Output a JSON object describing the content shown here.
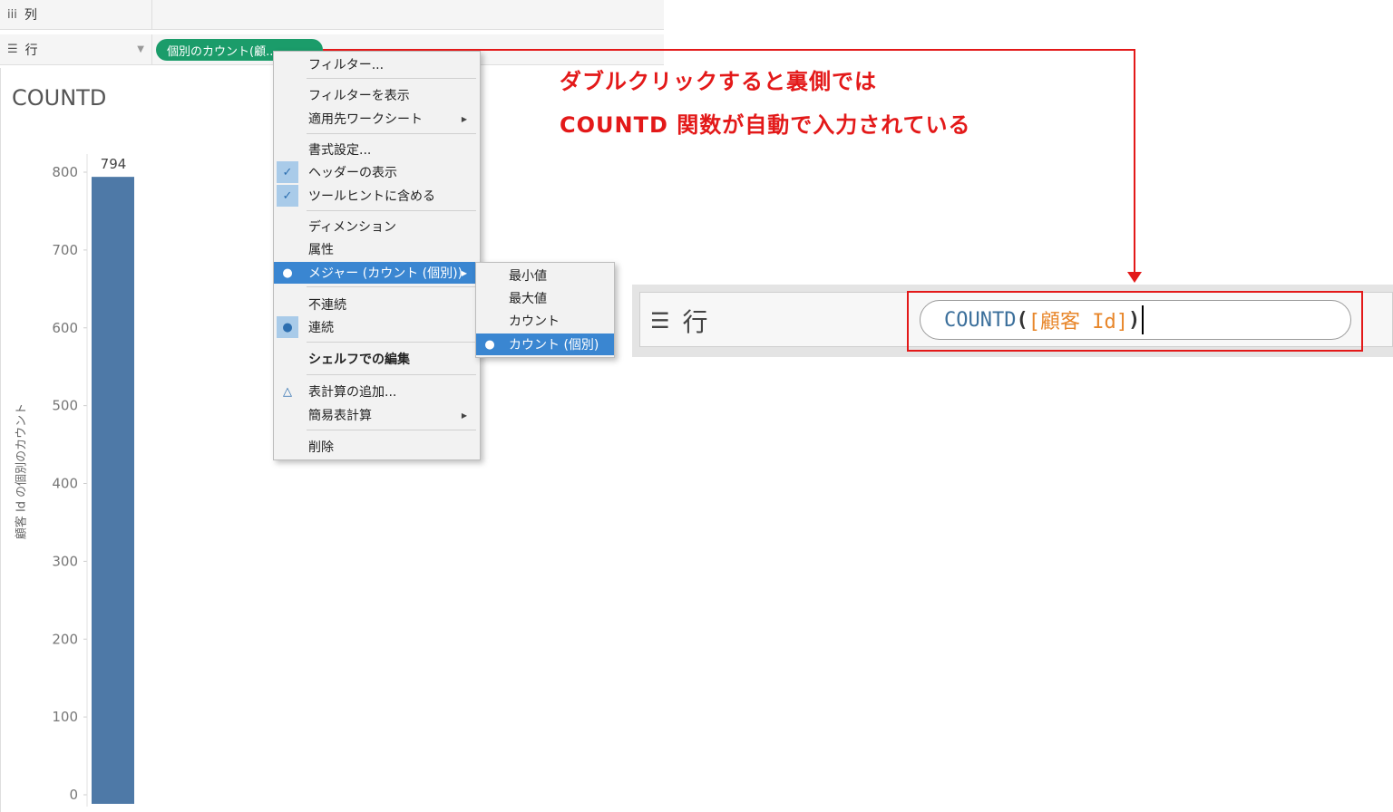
{
  "shelves": {
    "columns_icon": "iii",
    "columns_label": "列",
    "rows_icon": "☰",
    "rows_label": "行",
    "rows_pill": "個別のカウント(顧..."
  },
  "chart": {
    "title": "COUNTD"
  },
  "chart_data": {
    "type": "bar",
    "categories": [
      ""
    ],
    "values": [
      794
    ],
    "data_labels": [
      "794"
    ],
    "title": "COUNTD",
    "xlabel": "",
    "ylabel": "顧客 Id の個別のカウント",
    "ylim": [
      0,
      850
    ],
    "yticks": [
      0,
      100,
      200,
      300,
      400,
      500,
      600,
      700,
      800
    ],
    "grid": false,
    "bar_color": "#4e79a7"
  },
  "context_menu": {
    "items": [
      {
        "label": "フィルター...",
        "mark": "",
        "arrow": false,
        "bold": false,
        "selected": false
      },
      {
        "label": "フィルターを表示",
        "mark": "",
        "arrow": false,
        "bold": false,
        "selected": false
      },
      {
        "label": "適用先ワークシート",
        "mark": "",
        "arrow": true,
        "bold": false,
        "selected": false
      },
      {
        "label": "書式設定...",
        "mark": "",
        "arrow": false,
        "bold": false,
        "selected": false
      },
      {
        "label": "ヘッダーの表示",
        "mark": "✓",
        "arrow": false,
        "bold": false,
        "selected": false
      },
      {
        "label": "ツールヒントに含める",
        "mark": "✓",
        "arrow": false,
        "bold": false,
        "selected": false
      },
      {
        "label": "ディメンション",
        "mark": "",
        "arrow": false,
        "bold": false,
        "selected": false
      },
      {
        "label": "属性",
        "mark": "",
        "arrow": false,
        "bold": false,
        "selected": false
      },
      {
        "label": "メジャー (カウント (個別))",
        "mark": "●",
        "arrow": true,
        "bold": false,
        "selected": true
      },
      {
        "label": "不連続",
        "mark": "",
        "arrow": false,
        "bold": false,
        "selected": false
      },
      {
        "label": "連続",
        "mark": "●",
        "arrow": false,
        "bold": false,
        "selected": false
      },
      {
        "label": "シェルフでの編集",
        "mark": "",
        "arrow": false,
        "bold": true,
        "selected": false
      },
      {
        "label": "表計算の追加...",
        "mark": "△",
        "arrow": false,
        "bold": false,
        "selected": false
      },
      {
        "label": "簡易表計算",
        "mark": "",
        "arrow": true,
        "bold": false,
        "selected": false
      },
      {
        "label": "削除",
        "mark": "",
        "arrow": false,
        "bold": false,
        "selected": false
      }
    ]
  },
  "submenu": {
    "items": [
      {
        "label": "最小値",
        "mark": "",
        "selected": false
      },
      {
        "label": "最大値",
        "mark": "",
        "selected": false
      },
      {
        "label": "カウント",
        "mark": "",
        "selected": false
      },
      {
        "label": "カウント (個別)",
        "mark": "●",
        "selected": true
      }
    ]
  },
  "annotation": {
    "line1": "ダブルクリックすると裏側では",
    "line2": "COUNTD 関数が自動で入力されている",
    "color": "#e31919"
  },
  "zoom": {
    "icon": "☰",
    "label": "行",
    "formula_fn": "COUNTD",
    "formula_open": "(",
    "formula_field": "[顧客 Id]",
    "formula_close": ")"
  }
}
